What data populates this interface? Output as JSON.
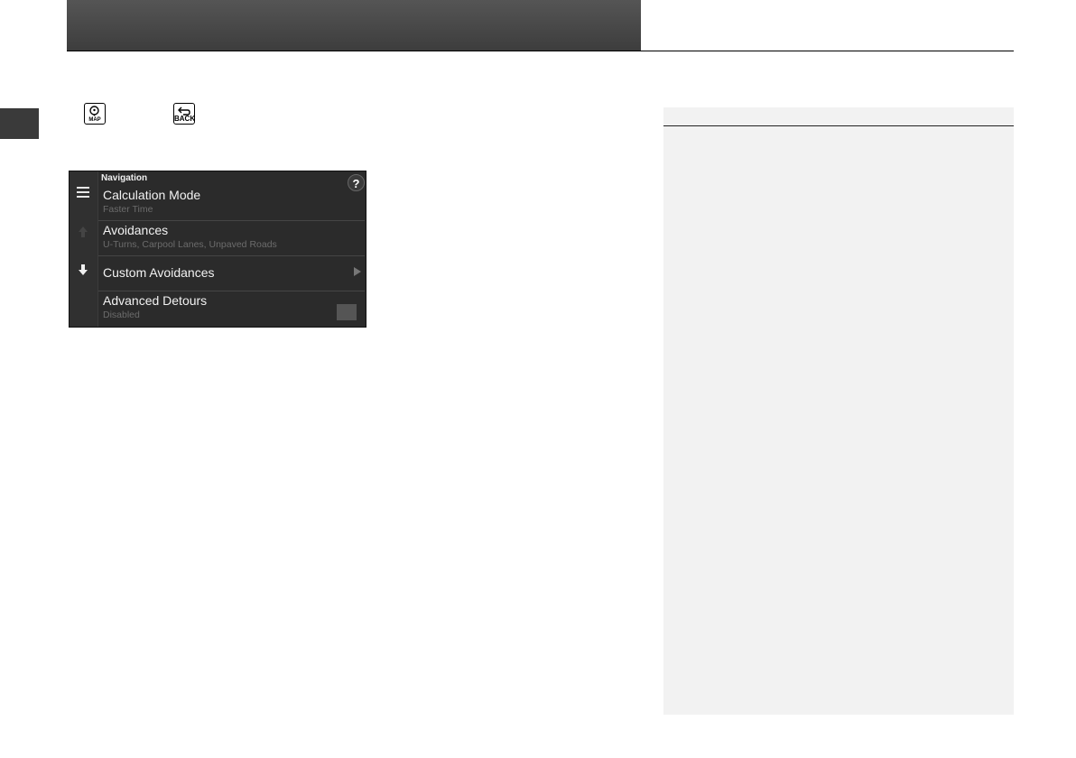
{
  "buttons": {
    "map_label": "MAP",
    "back_label": "BACK"
  },
  "screen": {
    "title": "Navigation",
    "help_label": "?",
    "items": [
      {
        "title": "Calculation Mode",
        "subtitle": "Faster Time"
      },
      {
        "title": "Avoidances",
        "subtitle": "U-Turns, Carpool Lanes, Unpaved Roads"
      },
      {
        "title": "Custom Avoidances",
        "subtitle": ""
      },
      {
        "title": "Advanced Detours",
        "subtitle": "Disabled"
      }
    ]
  },
  "icons": {
    "menu": "menu-icon",
    "scroll_up": "arrow-up-icon",
    "scroll_down": "arrow-down-icon",
    "chevron": "chevron-right-icon",
    "help": "help-icon",
    "map": "map-icon",
    "back": "back-icon"
  },
  "colors": {
    "header": "#4a4a4a",
    "screen_bg": "#2b2b2b",
    "sidebar_bg": "#f2f2f2"
  }
}
